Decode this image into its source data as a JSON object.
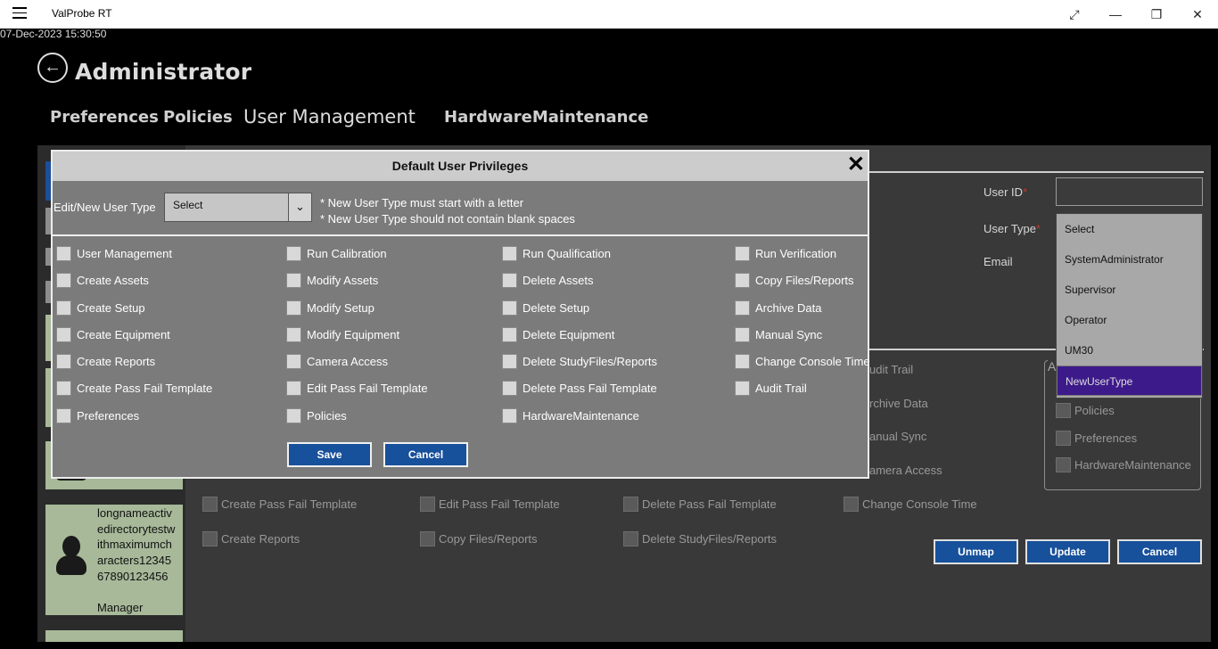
{
  "window": {
    "title": "ValProbe RT",
    "datetime": "07-Dec-2023 15:30:50"
  },
  "page": {
    "title": "Administrator"
  },
  "tabs": [
    "Preferences",
    "Policies",
    "User Management",
    "HardwareMaintenance"
  ],
  "users": [
    {
      "name": "longnameactivedirectorytestwithmaximumcharacters1234567890123456",
      "role": "Manager"
    }
  ],
  "form": {
    "user_id_label": "User ID",
    "user_type_label": "User Type",
    "email_label": "Email",
    "required_mark": "*",
    "user_type_options": [
      "Select",
      "SystemAdministrator",
      "Supervisor",
      "Operator",
      "UM30",
      "NewUserType"
    ],
    "selected_user_type": "NewUserType",
    "group_letter": "A"
  },
  "background_privileges": {
    "partial": [
      "udit Trail",
      "rchive Data",
      "anual Sync",
      "amera Access"
    ],
    "row1": [
      "Create Pass Fail Template",
      "Edit Pass Fail Template",
      "Delete Pass Fail Template",
      "Change Console Time"
    ],
    "row2": [
      "Create Reports",
      "Copy Files/Reports",
      "Delete StudyFiles/Reports"
    ],
    "group": [
      "Policies",
      "Preferences",
      "HardwareMaintenance"
    ]
  },
  "buttons": {
    "unmap": "Unmap",
    "update": "Update",
    "cancel": "Cancel"
  },
  "modal": {
    "title": "Default User Privileges",
    "close": "✕",
    "edit_label": "Edit/New User Type",
    "select_value": "Select",
    "note1": "* New User Type must start with a letter",
    "note2": "* New User Type should not contain blank spaces",
    "columns": [
      [
        "User Management",
        "Create Assets",
        "Create Setup",
        "Create Equipment",
        "Create Reports",
        "Create Pass Fail Template",
        "Preferences"
      ],
      [
        "Run Calibration",
        "Modify Assets",
        "Modify Setup",
        "Modify Equipment",
        "Camera Access",
        "Edit Pass Fail Template",
        "Policies"
      ],
      [
        "Run Qualification",
        "Delete Assets",
        "Delete Setup",
        "Delete Equipment",
        "Delete StudyFiles/Reports",
        "Delete Pass Fail Template",
        "HardwareMaintenance"
      ],
      [
        "Run Verification",
        "Copy Files/Reports",
        "Archive Data",
        "Manual Sync",
        "Change Console Time",
        "Audit Trail"
      ]
    ],
    "save": "Save",
    "cancel": "Cancel"
  }
}
